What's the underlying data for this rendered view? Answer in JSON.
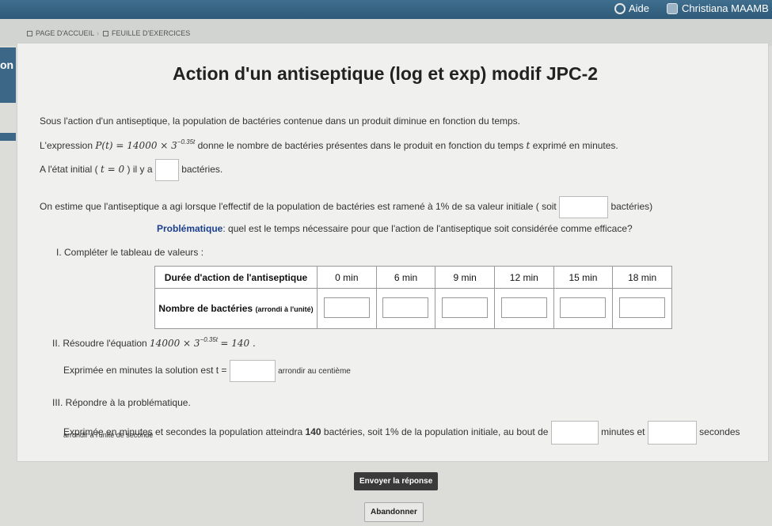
{
  "topbar": {
    "help": "Aide",
    "user": "Christiana MAAMB"
  },
  "breadcrumb": {
    "home": "PAGE D'ACCUEIL",
    "exercises": "FEUILLE D'EXERCICES"
  },
  "side_tab": "on",
  "title": "Action d'un antiseptique (log et exp) modif JPC-2",
  "intro": "Sous l'action d'un antiseptique, la population de bactéries contenue dans un produit diminue en fonction du temps.",
  "expression": {
    "prefix": "L'expression",
    "func": "P(t) = 14000 × 3",
    "exponent": "−0.35t",
    "suffix": "donne le nombre de bactéries présentes dans le produit en fonction du temps",
    "var": "t",
    "suffix2": "exprimé en minutes."
  },
  "initial": {
    "prefix": "A l'état initial (",
    "cond": "t = 0",
    "mid": ") il y a",
    "suffix": "bactéries."
  },
  "estimate": {
    "text": "On estime que l'antiseptique a agi lorsque l'effectif de la population de bactéries est ramené à 1% de sa valeur initiale ( soit",
    "suffix": "bactéries)"
  },
  "problem": {
    "label": "Problématique",
    "text": ": quel est le temps nécessaire pour que l'action de l'antiseptique soit considérée comme efficace?"
  },
  "part1": {
    "label": "I. Compléter le tableau de valeurs :",
    "row1_header": "Durée d'action de l'antiseptique",
    "row2_header": "Nombre de bactéries",
    "row2_note": "(arrondi à l'unité)",
    "times": [
      "0 min",
      "6 min",
      "9 min",
      "12 min",
      "15 min",
      "18 min"
    ]
  },
  "part2": {
    "label": "II. Résoudre l'équation",
    "eq_base": "14000 × 3",
    "eq_exp": "−0.35t",
    "eq_rhs": "= 140 .",
    "solution_prefix": "Exprimée en minutes la solution est t =",
    "solution_suffix": "arrondir au centième"
  },
  "part3": {
    "label": "III. Répondre à la problématique.",
    "text_a": "Exprimée en minutes et secondes la population atteindra",
    "value": "140",
    "text_b": "bactéries, soit 1% de la population initiale, au bout de",
    "minutes": "minutes et",
    "seconds": "secondes",
    "note": "arrondir à l'unité de seconde"
  },
  "buttons": {
    "submit": "Envoyer la réponse",
    "abandon": "Abandonner"
  }
}
